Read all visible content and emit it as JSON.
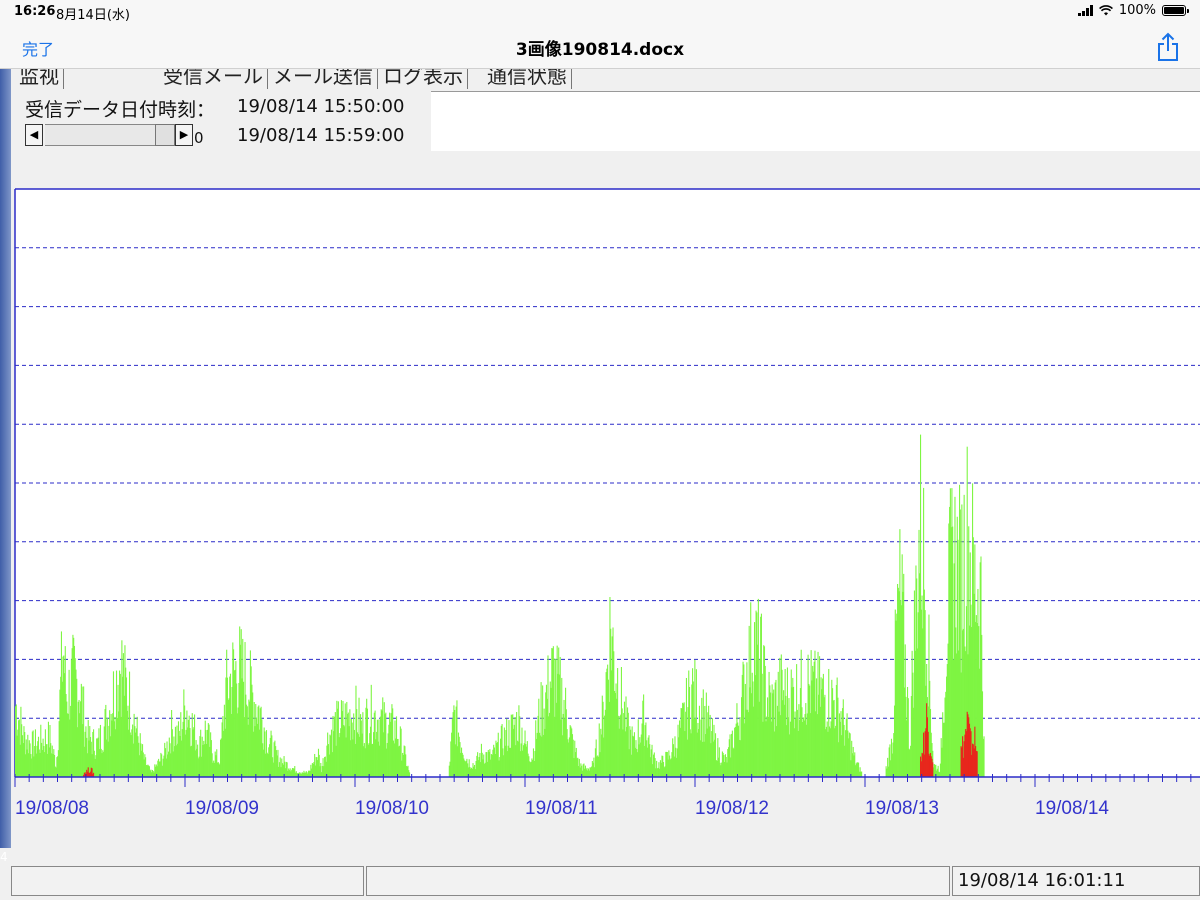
{
  "status_bar": {
    "time": "16:26",
    "date": "8月14日(水)",
    "battery_percent": "100%",
    "battery_level": 1.0
  },
  "nav": {
    "done_label": "完了",
    "title": "3画像190814.docx",
    "share_icon": "share-icon"
  },
  "tabs": [
    {
      "label": "监视"
    },
    {
      "label": "受信メール"
    },
    {
      "label": "メール送信"
    },
    {
      "label": "ログ表示"
    },
    {
      "label": "通信状態"
    }
  ],
  "info": {
    "label": "受信データ日付時刻：",
    "time1": "19/08/14 15:50:00",
    "time2": "19/08/14 15:59:00",
    "scroll_value": "0"
  },
  "bottom": {
    "clock": "19/08/14 16:01:11",
    "left_edge": "4"
  },
  "colors": {
    "green": "#7ef542",
    "red": "#e8261c",
    "axis": "#2b2bc8",
    "grid": "#2b2bc8",
    "label": "#3333cc"
  },
  "chart_data": {
    "type": "bar",
    "title": "",
    "xlabel": "",
    "ylabel": "",
    "ylim": [
      0,
      10
    ],
    "x_start": "19/08/08",
    "x_end_fraction_days": 6.95,
    "tick_labels": [
      "19/08/08",
      "19/08/09",
      "19/08/10",
      "19/08/11",
      "19/08/12",
      "19/08/13",
      "19/08/14"
    ],
    "grid": "dashed horizontal",
    "series": [
      {
        "color": "green",
        "envelope": [
          [
            0.0,
            1.8
          ],
          [
            0.05,
            1.0
          ],
          [
            0.1,
            0.8
          ],
          [
            0.15,
            0.9
          ],
          [
            0.2,
            1.0
          ],
          [
            0.24,
            0.3
          ],
          [
            0.28,
            3.3
          ],
          [
            0.3,
            2.0
          ],
          [
            0.34,
            2.5
          ],
          [
            0.38,
            2.2
          ],
          [
            0.42,
            1.0
          ],
          [
            0.48,
            0.8
          ],
          [
            0.52,
            1.2
          ],
          [
            0.56,
            1.8
          ],
          [
            0.6,
            2.5
          ],
          [
            0.62,
            2.9
          ],
          [
            0.64,
            2.4
          ],
          [
            0.68,
            1.8
          ],
          [
            0.72,
            1.0
          ],
          [
            0.76,
            0.4
          ],
          [
            0.8,
            0.1
          ],
          [
            0.88,
            0.6
          ],
          [
            0.92,
            1.2
          ],
          [
            0.96,
            1.0
          ],
          [
            1.0,
            1.8
          ],
          [
            1.04,
            1.3
          ],
          [
            1.08,
            0.8
          ],
          [
            1.12,
            1.2
          ],
          [
            1.16,
            0.6
          ],
          [
            1.2,
            0.4
          ],
          [
            1.24,
            2.2
          ],
          [
            1.28,
            2.6
          ],
          [
            1.32,
            2.7
          ],
          [
            1.36,
            2.4
          ],
          [
            1.4,
            2.0
          ],
          [
            1.44,
            1.6
          ],
          [
            1.48,
            1.0
          ],
          [
            1.54,
            0.5
          ],
          [
            1.6,
            0.3
          ],
          [
            1.66,
            0.15
          ],
          [
            1.72,
            0.1
          ],
          [
            1.78,
            0.6
          ],
          [
            1.8,
            0.2
          ],
          [
            1.84,
            1.0
          ],
          [
            1.88,
            1.3
          ],
          [
            1.92,
            1.4
          ],
          [
            1.96,
            1.5
          ],
          [
            2.0,
            1.6
          ],
          [
            2.04,
            1.2
          ],
          [
            2.08,
            1.6
          ],
          [
            2.12,
            1.5
          ],
          [
            2.16,
            1.4
          ],
          [
            2.2,
            1.3
          ],
          [
            2.24,
            1.2
          ],
          [
            2.28,
            0.7
          ],
          [
            2.32,
            0.05
          ],
          [
            2.55,
            0.2
          ],
          [
            2.58,
            1.6
          ],
          [
            2.62,
            0.9
          ],
          [
            2.66,
            0.4
          ],
          [
            2.7,
            0.3
          ],
          [
            2.74,
            0.6
          ],
          [
            2.8,
            0.5
          ],
          [
            2.86,
            0.9
          ],
          [
            2.92,
            1.2
          ],
          [
            2.96,
            1.4
          ],
          [
            3.0,
            0.8
          ],
          [
            3.04,
            0.5
          ],
          [
            3.08,
            1.5
          ],
          [
            3.12,
            2.0
          ],
          [
            3.16,
            2.6
          ],
          [
            3.2,
            2.2
          ],
          [
            3.24,
            1.6
          ],
          [
            3.28,
            0.8
          ],
          [
            3.32,
            0.3
          ],
          [
            3.36,
            0.2
          ],
          [
            3.4,
            0.3
          ],
          [
            3.44,
            1.2
          ],
          [
            3.46,
            1.6
          ],
          [
            3.5,
            3.8
          ],
          [
            3.52,
            3.0
          ],
          [
            3.56,
            2.0
          ],
          [
            3.6,
            1.2
          ],
          [
            3.64,
            0.8
          ],
          [
            3.7,
            1.5
          ],
          [
            3.74,
            0.6
          ],
          [
            3.78,
            0.3
          ],
          [
            3.84,
            0.5
          ],
          [
            3.9,
            1.0
          ],
          [
            3.94,
            1.6
          ],
          [
            3.98,
            2.2
          ],
          [
            4.02,
            1.8
          ],
          [
            4.06,
            1.5
          ],
          [
            4.1,
            1.0
          ],
          [
            4.14,
            0.6
          ],
          [
            4.18,
            0.4
          ],
          [
            4.22,
            1.0
          ],
          [
            4.26,
            1.6
          ],
          [
            4.3,
            2.6
          ],
          [
            4.34,
            3.4
          ],
          [
            4.38,
            3.0
          ],
          [
            4.42,
            2.0
          ],
          [
            4.46,
            1.8
          ],
          [
            4.5,
            2.2
          ],
          [
            4.54,
            2.0
          ],
          [
            4.58,
            2.1
          ],
          [
            4.62,
            2.2
          ],
          [
            4.66,
            2.3
          ],
          [
            4.7,
            2.2
          ],
          [
            4.74,
            2.1
          ],
          [
            4.78,
            2.0
          ],
          [
            4.82,
            1.9
          ],
          [
            4.86,
            1.5
          ],
          [
            4.9,
            1.0
          ],
          [
            4.94,
            0.4
          ],
          [
            4.98,
            0.1
          ],
          [
            5.12,
            0.2
          ],
          [
            5.16,
            1.0
          ],
          [
            5.18,
            3.5
          ],
          [
            5.2,
            4.5
          ],
          [
            5.22,
            3.8
          ],
          [
            5.24,
            2.5
          ],
          [
            5.26,
            0.8
          ],
          [
            5.28,
            3.0
          ],
          [
            5.3,
            4.5
          ],
          [
            5.32,
            6.3
          ],
          [
            5.34,
            5.5
          ],
          [
            5.36,
            4.0
          ],
          [
            5.4,
            0.3
          ],
          [
            5.44,
            0.2
          ],
          [
            5.48,
            4.0
          ],
          [
            5.5,
            5.0
          ],
          [
            5.52,
            5.5
          ],
          [
            5.54,
            5.2
          ],
          [
            5.56,
            5.0
          ],
          [
            5.58,
            5.6
          ],
          [
            5.6,
            6.0
          ],
          [
            5.62,
            5.6
          ],
          [
            5.64,
            4.8
          ],
          [
            5.66,
            4.8
          ],
          [
            5.68,
            4.6
          ],
          [
            5.7,
            0.1
          ]
        ]
      },
      {
        "color": "red",
        "envelope": [
          [
            0.4,
            0.1
          ],
          [
            0.44,
            0.2
          ],
          [
            0.46,
            0.1
          ],
          [
            2.76,
            0.05
          ],
          [
            5.32,
            0.4
          ],
          [
            5.34,
            0.8
          ],
          [
            5.36,
            1.5
          ],
          [
            5.38,
            0.9
          ],
          [
            5.4,
            0.4
          ],
          [
            5.56,
            0.6
          ],
          [
            5.58,
            0.9
          ],
          [
            5.6,
            1.4
          ],
          [
            5.62,
            0.8
          ],
          [
            5.64,
            1.0
          ],
          [
            5.66,
            0.5
          ]
        ]
      }
    ]
  }
}
